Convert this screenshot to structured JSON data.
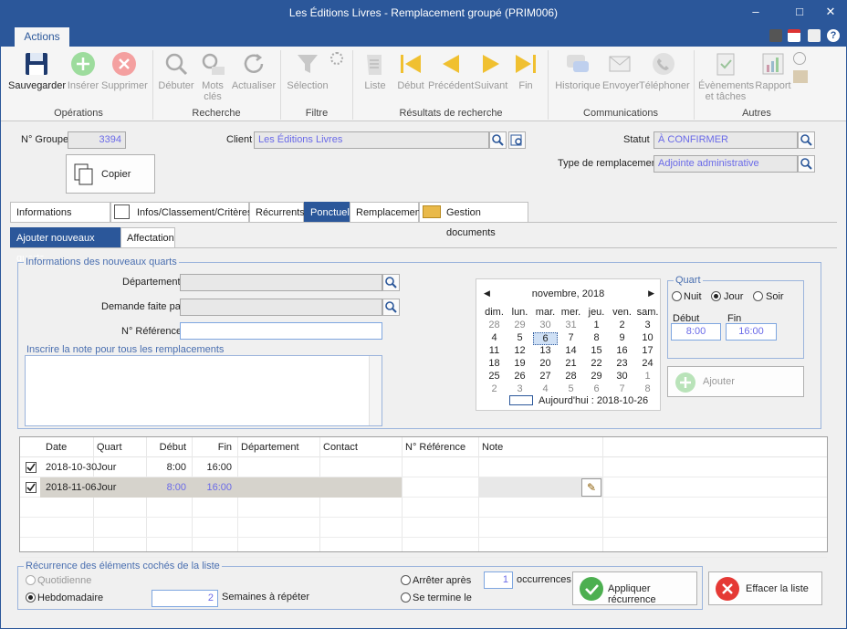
{
  "window": {
    "title": "Les Éditions Livres - Remplacement groupé (PRIM006)"
  },
  "ribbon": {
    "tab": "Actions",
    "buttons": {
      "save": "Sauvegarder",
      "insert": "Insérer",
      "delete": "Supprimer",
      "start_search": "Débuter",
      "keywords": "Mots clés",
      "refresh": "Actualiser",
      "selection": "Sélection",
      "list": "Liste",
      "first": "Début",
      "previous": "Précédent",
      "next": "Suivant",
      "last": "Fin",
      "history": "Historique",
      "send": "Envoyer",
      "phone": "Téléphoner",
      "events": "Évènements et tâches",
      "report": "Rapport"
    },
    "groups": {
      "operations": "Opérations",
      "search": "Recherche",
      "filter": "Filtre",
      "results": "Résultats de recherche",
      "communications": "Communications",
      "others": "Autres"
    }
  },
  "header": {
    "group_label": "N° Groupe",
    "group_value": "3394",
    "client_label": "Client",
    "client_value": "Les Éditions Livres",
    "status_label": "Statut",
    "status_value": "À CONFIRMER",
    "type_label": "Type de remplacement",
    "type_value": "Adjointe administrative",
    "copy_button": "Copier"
  },
  "tabs": [
    "Informations générales",
    "Infos/Classement/Critères",
    "Récurrents",
    "Ponctuel",
    "Remplacements",
    "Gestion documents"
  ],
  "subtabs": [
    "Ajouter nouveaux quarts",
    "Affectation"
  ],
  "new_shifts": {
    "legend": "Informations des nouveaux quarts",
    "department_label": "Département",
    "requested_by_label": "Demande faite par",
    "reference_label": "N° Référence",
    "note_label": "Inscrire la note pour tous les remplacements"
  },
  "calendar": {
    "month": "novembre, 2018",
    "days": [
      "dim.",
      "lun.",
      "mar.",
      "mer.",
      "jeu.",
      "ven.",
      "sam."
    ],
    "weeks": [
      [
        "28",
        "29",
        "30",
        "31",
        "1",
        "2",
        "3"
      ],
      [
        "4",
        "5",
        "6",
        "7",
        "8",
        "9",
        "10"
      ],
      [
        "11",
        "12",
        "13",
        "14",
        "15",
        "16",
        "17"
      ],
      [
        "18",
        "19",
        "20",
        "21",
        "22",
        "23",
        "24"
      ],
      [
        "25",
        "26",
        "27",
        "28",
        "29",
        "30",
        "1"
      ],
      [
        "2",
        "3",
        "4",
        "5",
        "6",
        "7",
        "8"
      ]
    ],
    "today": "Aujourd'hui : 2018-10-26"
  },
  "shift": {
    "legend": "Quart",
    "options": [
      "Nuit",
      "Jour",
      "Soir"
    ],
    "selected": "Jour",
    "start_label": "Début",
    "end_label": "Fin",
    "start": "8:00",
    "end": "16:00",
    "add_button": "Ajouter"
  },
  "grid": {
    "columns": [
      "Date",
      "Quart",
      "Début",
      "Fin",
      "Département",
      "Contact",
      "N° Référence",
      "Note"
    ],
    "rows": [
      {
        "date": "2018-10-30",
        "quart": "Jour",
        "debut": "8:00",
        "fin": "16:00",
        "checked": true
      },
      {
        "date": "2018-11-06",
        "quart": "Jour",
        "debut": "8:00",
        "fin": "16:00",
        "checked": true
      }
    ]
  },
  "recurrence": {
    "legend": "Récurrence des éléments cochés de la liste",
    "daily": "Quotidienne",
    "weekly": "Hebdomadaire",
    "weeks_value": "2",
    "weeks_label": "Semaines à répéter",
    "stop_after": "Arrêter après",
    "occurrences_value": "1",
    "occurrences_label": "occurrences",
    "ends_on": "Se termine le",
    "apply_button": "Appliquer récurrence",
    "clear_button": "Effacer la liste"
  },
  "colors": {
    "brand": "#2b579a",
    "field_text": "#6a6ae8",
    "green": "#4caf50",
    "red": "#e53935"
  }
}
